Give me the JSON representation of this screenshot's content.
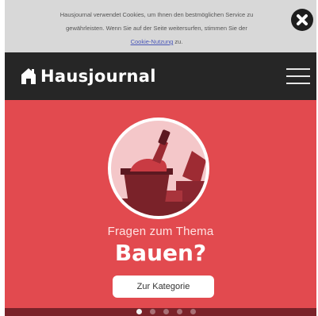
{
  "cookie_banner": {
    "text_line1": "Hausjournal verwendet Cookies, um Ihnen den bestmöglichen Service zu",
    "text_line2": "gewährleisten. Wenn Sie auf der Seite weitersurfen, stimmen Sie der",
    "link_text": "Cookie-Nutzung",
    "suffix": " zu.",
    "close_icon": "close-x-icon"
  },
  "header": {
    "logo_text": "Hausjournal",
    "logo_icon": "house-icon",
    "menu_icon": "hamburger-menu-icon"
  },
  "hero": {
    "subtitle": "Fragen zum Thema",
    "title": "Bauen?",
    "button_label": "Zur Kategorie",
    "illustration": "construction-bucket-trowel-icon",
    "colors": {
      "background": "#e24a4f",
      "dark": "#262626",
      "accent": "#7a2229"
    }
  },
  "carousel": {
    "dots": 5,
    "active_index": 0
  }
}
